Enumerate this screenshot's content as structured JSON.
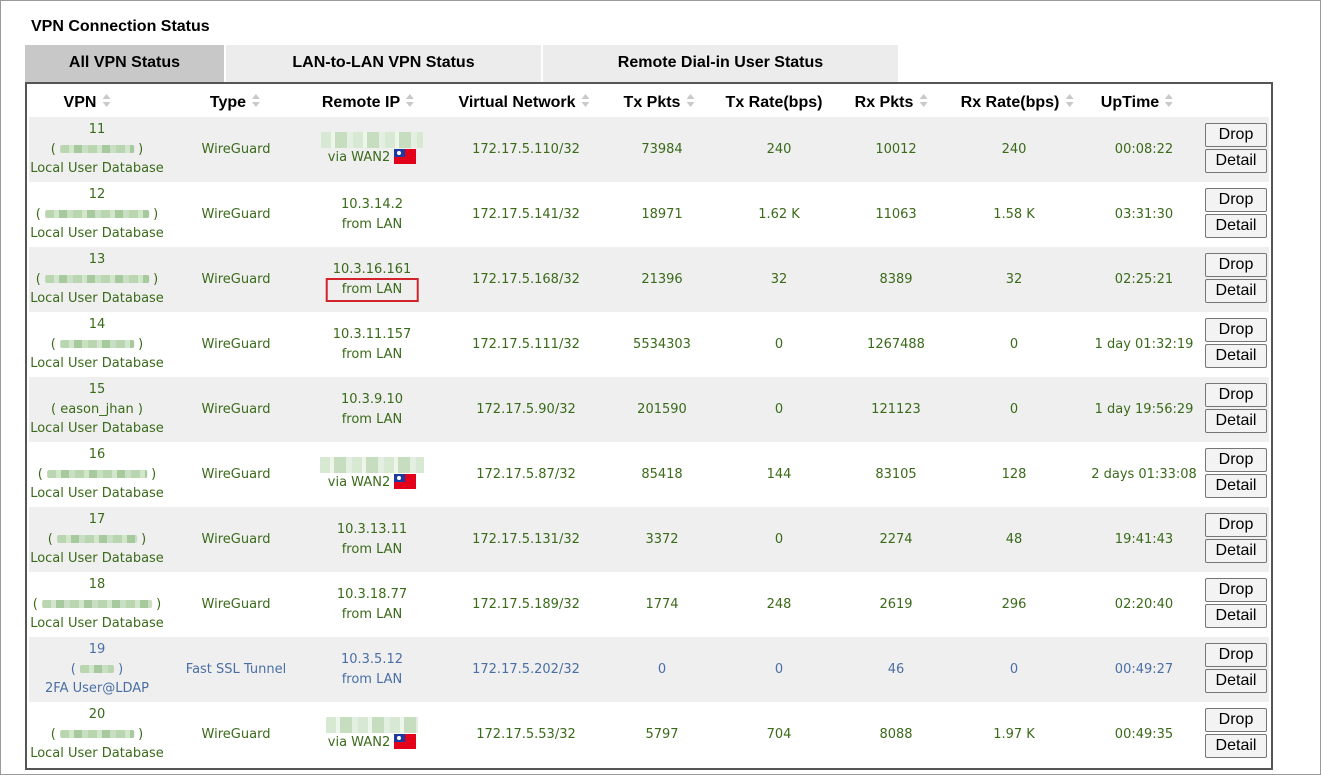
{
  "page": {
    "title": "VPN Connection Status"
  },
  "tabs": [
    {
      "label": "All VPN Status",
      "active": true
    },
    {
      "label": "LAN-to-LAN VPN Status",
      "active": false
    },
    {
      "label": "Remote Dial-in User Status",
      "active": false
    }
  ],
  "columns": [
    "VPN",
    "Type",
    "Remote IP",
    "Virtual Network",
    "Tx Pkts",
    "Tx Rate(bps)",
    "Rx Pkts",
    "Rx Rate(bps)",
    "UpTime"
  ],
  "buttons": {
    "drop": "Drop",
    "detail": "Detail"
  },
  "colors": {
    "green_text": "#3a6a1a",
    "blue_text": "#4a6fa5",
    "highlight": "#d2232a"
  },
  "rows": [
    {
      "vpn": "11",
      "user": "",
      "source": "Local User Database",
      "type": "WireGuard",
      "remote_ip": "",
      "remote_via": "via WAN2",
      "flag": true,
      "vnet": "172.17.5.110/32",
      "tx_pkts": "73984",
      "tx_rate": "240",
      "rx_pkts": "10012",
      "rx_rate": "240",
      "uptime": "00:08:22"
    },
    {
      "vpn": "12",
      "user": "",
      "source": "Local User Database",
      "type": "WireGuard",
      "remote_ip": "10.3.14.2",
      "remote_via": "from LAN",
      "flag": false,
      "vnet": "172.17.5.141/32",
      "tx_pkts": "18971",
      "tx_rate": "1.62 K",
      "rx_pkts": "11063",
      "rx_rate": "1.58 K",
      "uptime": "03:31:30"
    },
    {
      "vpn": "13",
      "user": "",
      "source": "Local User Database",
      "type": "WireGuard",
      "remote_ip": "10.3.16.161",
      "remote_via": "from LAN",
      "flag": false,
      "highlight": true,
      "vnet": "172.17.5.168/32",
      "tx_pkts": "21396",
      "tx_rate": "32",
      "rx_pkts": "8389",
      "rx_rate": "32",
      "uptime": "02:25:21"
    },
    {
      "vpn": "14",
      "user": "",
      "source": "Local User Database",
      "type": "WireGuard",
      "remote_ip": "10.3.11.157",
      "remote_via": "from LAN",
      "flag": false,
      "vnet": "172.17.5.111/32",
      "tx_pkts": "5534303",
      "tx_rate": "0",
      "rx_pkts": "1267488",
      "rx_rate": "0",
      "uptime": "1 day 01:32:19"
    },
    {
      "vpn": "15",
      "user": "eason_jhan",
      "source": "Local User Database",
      "type": "WireGuard",
      "remote_ip": "10.3.9.10",
      "remote_via": "from LAN",
      "flag": false,
      "vnet": "172.17.5.90/32",
      "tx_pkts": "201590",
      "tx_rate": "0",
      "rx_pkts": "121123",
      "rx_rate": "0",
      "uptime": "1 day 19:56:29"
    },
    {
      "vpn": "16",
      "user": "",
      "source": "Local User Database",
      "type": "WireGuard",
      "remote_ip": "",
      "remote_via": "via WAN2",
      "flag": true,
      "vnet": "172.17.5.87/32",
      "tx_pkts": "85418",
      "tx_rate": "144",
      "rx_pkts": "83105",
      "rx_rate": "128",
      "uptime": "2 days 01:33:08"
    },
    {
      "vpn": "17",
      "user": "",
      "source": "Local User Database",
      "type": "WireGuard",
      "remote_ip": "10.3.13.11",
      "remote_via": "from LAN",
      "flag": false,
      "vnet": "172.17.5.131/32",
      "tx_pkts": "3372",
      "tx_rate": "0",
      "rx_pkts": "2274",
      "rx_rate": "48",
      "uptime": "19:41:43"
    },
    {
      "vpn": "18",
      "user": "",
      "source": "Local User Database",
      "type": "WireGuard",
      "remote_ip": "10.3.18.77",
      "remote_via": "from LAN",
      "flag": false,
      "vnet": "172.17.5.189/32",
      "tx_pkts": "1774",
      "tx_rate": "248",
      "rx_pkts": "2619",
      "rx_rate": "296",
      "uptime": "02:20:40"
    },
    {
      "vpn": "19",
      "user": "",
      "source": "2FA User@LDAP",
      "type": "Fast SSL Tunnel",
      "remote_ip": "10.3.5.12",
      "remote_via": "from LAN",
      "flag": false,
      "blue": true,
      "vnet": "172.17.5.202/32",
      "tx_pkts": "0",
      "tx_rate": "0",
      "rx_pkts": "46",
      "rx_rate": "0",
      "uptime": "00:49:27"
    },
    {
      "vpn": "20",
      "user": "",
      "source": "Local User Database",
      "type": "WireGuard",
      "remote_ip": "",
      "remote_via": "via WAN2",
      "flag": true,
      "vnet": "172.17.5.53/32",
      "tx_pkts": "5797",
      "tx_rate": "704",
      "rx_pkts": "8088",
      "rx_rate": "1.97 K",
      "uptime": "00:49:35"
    }
  ]
}
